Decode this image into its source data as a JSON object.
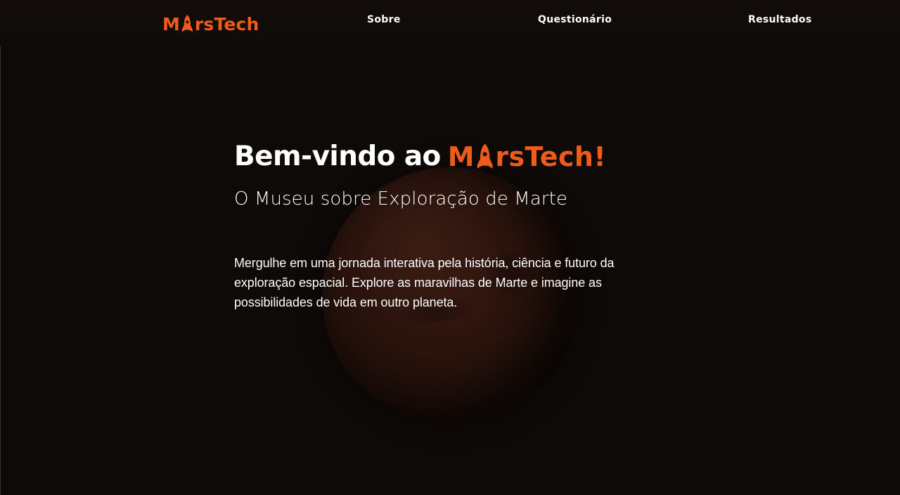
{
  "colors": {
    "background": "#0e0a08",
    "accent": "#f05a1a",
    "text": "#ffffff"
  },
  "header": {
    "logo": {
      "prefix": "M",
      "middle_icon": "rocket-icon",
      "suffix": "rsTech"
    },
    "nav": [
      {
        "label": "Sobre"
      },
      {
        "label": "Questionário"
      },
      {
        "label": "Resultados"
      }
    ]
  },
  "hero": {
    "title_prefix": "Bem-vindo ao",
    "brand": {
      "prefix": "M",
      "middle_icon": "rocket-icon",
      "suffix": "rsTech!"
    },
    "subtitle": "O Museu sobre Exploração de Marte",
    "description": "Mergulhe em uma jornada interativa pela história, ciência e futuro da exploração espacial. Explore as maravilhas de Marte e imagine as possibilidades de vida em outro planeta."
  },
  "background": {
    "image": "mars-planet-illustration"
  }
}
